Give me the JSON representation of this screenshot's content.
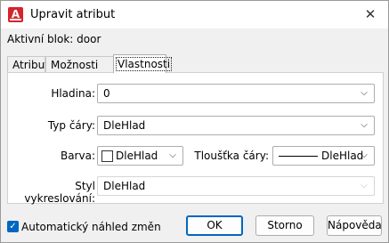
{
  "window": {
    "title": "Upravit atribut",
    "app_icon_letter": "A",
    "close_glyph": "✕"
  },
  "active_block": "Aktivní blok: door",
  "tabs": [
    {
      "label": "Atribut"
    },
    {
      "label": "Možnosti textu"
    },
    {
      "label": "Vlastnosti",
      "active": true
    }
  ],
  "properties": {
    "layer": {
      "label": "Hladina:",
      "value": "0"
    },
    "linetype": {
      "label": "Typ čáry:",
      "value": "DleHlad"
    },
    "color": {
      "label": "Barva:",
      "value": "DleHlad"
    },
    "lineweight": {
      "label": "Tloušťka čáry:",
      "value": "DleHlad"
    },
    "plotstyle": {
      "label": "Styl vykreslování:",
      "value": "DleHlad"
    }
  },
  "footer": {
    "auto_preview_label": "Automatický náhled změn",
    "auto_preview_checked": true,
    "ok_label": "OK",
    "cancel_label": "Storno",
    "help_label": "Nápověda"
  },
  "colors": {
    "accent": "#0067c0",
    "app_icon": "#d5242b"
  }
}
